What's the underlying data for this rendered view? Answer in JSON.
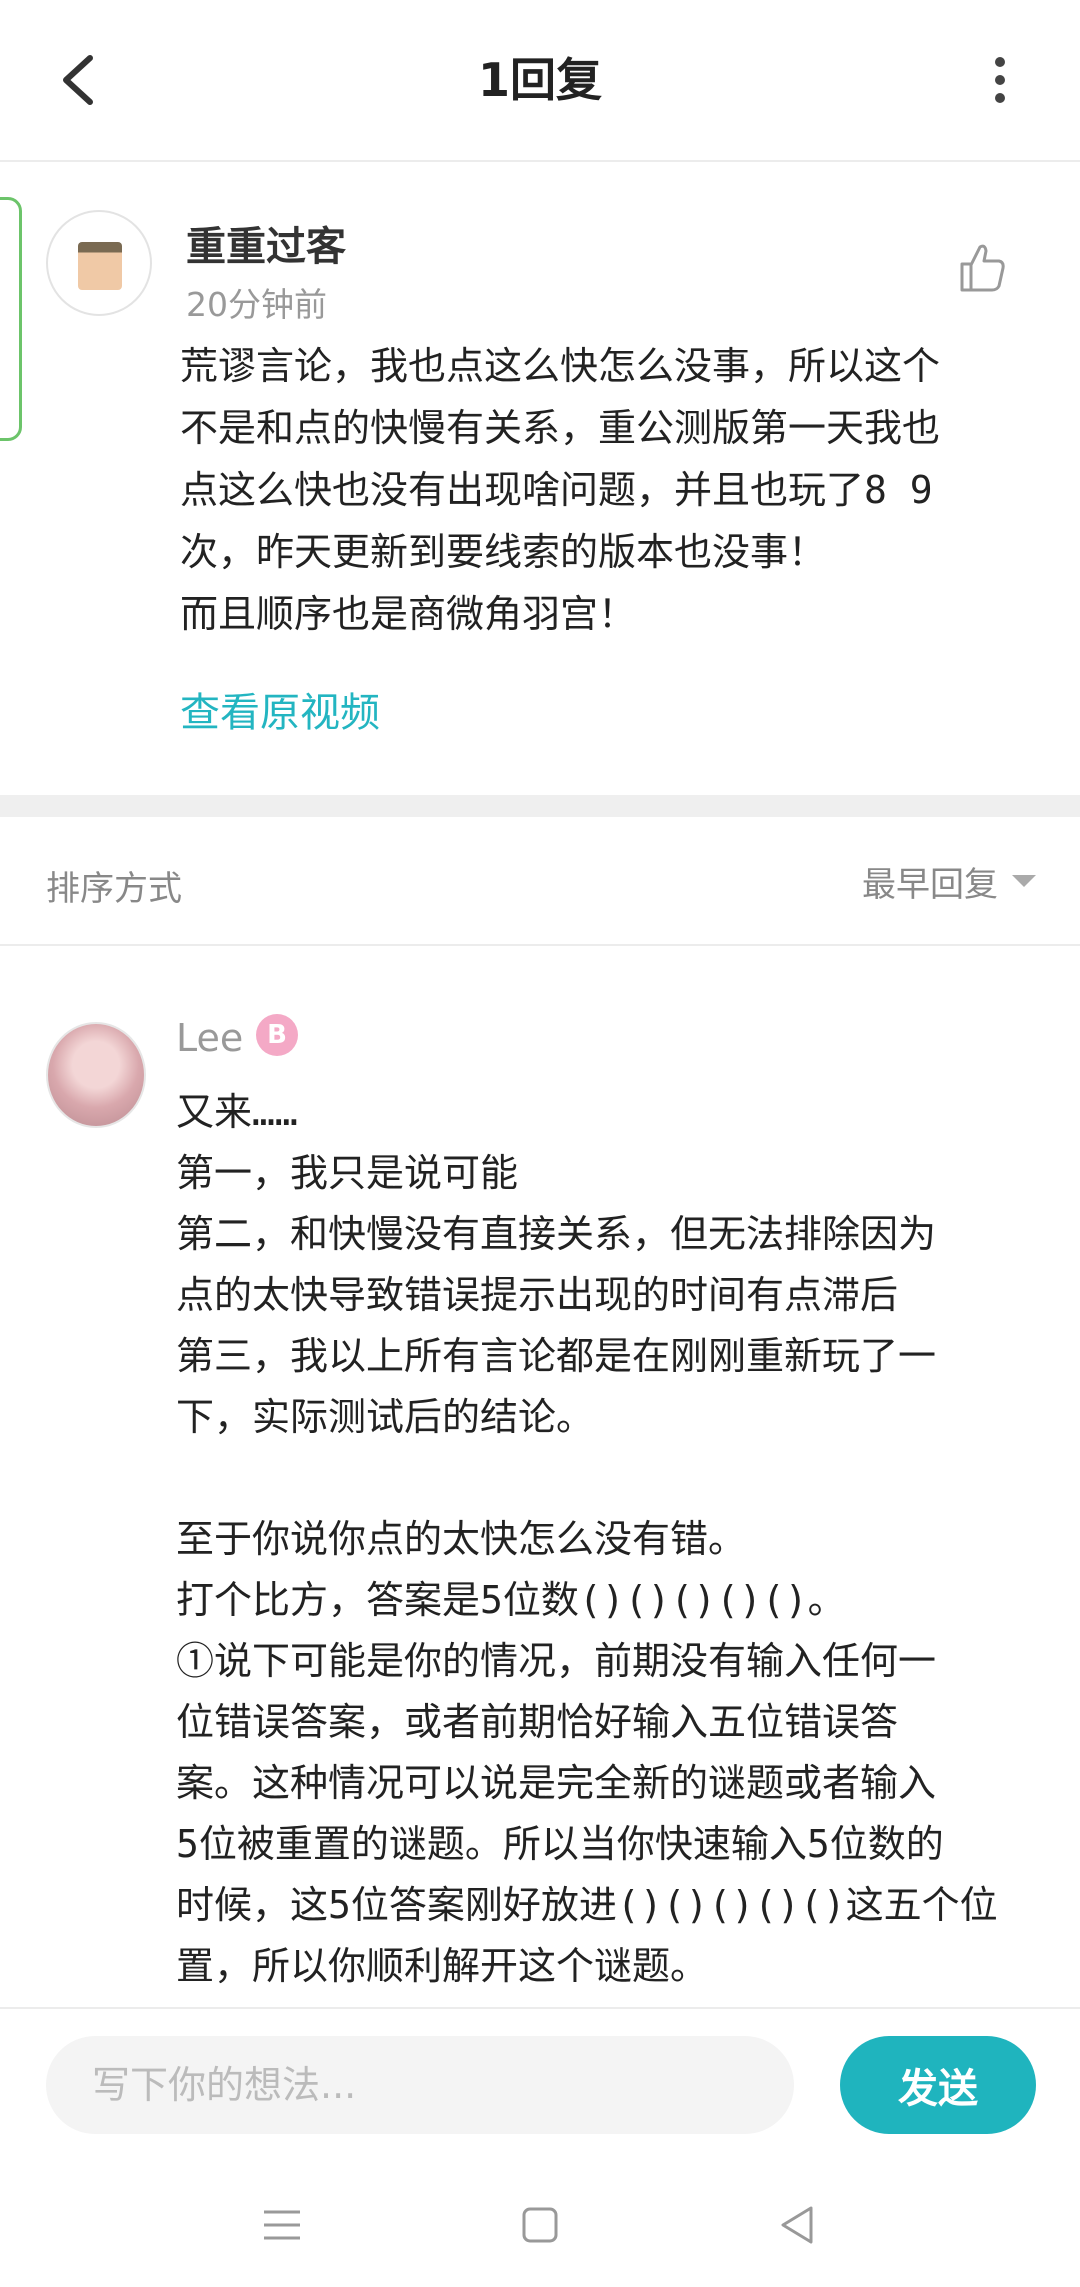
{
  "header": {
    "title": "1回复",
    "back_icon": "chevron-left-icon",
    "more_icon": "more-vertical-icon"
  },
  "comment": {
    "username": "重重过客",
    "time": "20分钟前",
    "text": "荒谬言论，我也点这么快怎么没事，所以这个\n不是和点的快慢有关系，重公测版第一天我也\n点这么快也没有出现啥问题，并且也玩了8 9\n次，昨天更新到要线索的版本也没事！\n而且顺序也是商微角羽宫！",
    "view_video": "查看原视频",
    "like_icon": "thumb-up-icon"
  },
  "sort": {
    "label": "排序方式",
    "value": "最早回复"
  },
  "reply": {
    "username": "Lee",
    "badge": "B",
    "text": "又来……\n第一，我只是说可能\n第二，和快慢没有直接关系，但无法排除因为\n点的太快导致错误提示出现的时间有点滞后\n第三，我以上所有言论都是在刚刚重新玩了一\n下，实际测试后的结论。\n\n至于你说你点的太快怎么没有错。\n打个比方，答案是5位数()()()()()。\n①说下可能是你的情况，前期没有输入任何一\n位错误答案，或者前期恰好输入五位错误答\n案。这种情况可以说是完全新的谜题或者输入\n5位被重置的谜题。所以当你快速输入5位数的\n时候，这5位答案刚好放进()()()()()这五个位\n置，所以你顺利解开这个谜题。"
  },
  "compose": {
    "placeholder": "写下你的想法...",
    "send_label": "发送"
  },
  "navbar": {
    "menu_icon": "menu-icon",
    "home_icon": "square-home-icon",
    "back_icon": "triangle-back-icon"
  },
  "colors": {
    "accent": "#1fb4be",
    "link": "#23b5c1",
    "green_tab": "#6cc46a"
  }
}
